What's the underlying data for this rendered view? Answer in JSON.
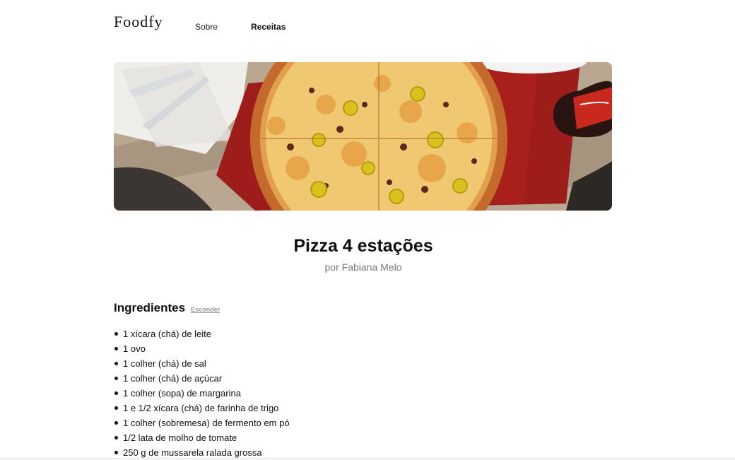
{
  "header": {
    "logo": "Foodfy",
    "nav": [
      {
        "label": "Sobre"
      },
      {
        "label": "Receitas"
      }
    ]
  },
  "hero": {
    "alt": "Pizza 4 estações"
  },
  "recipe": {
    "title": "Pizza 4 estações",
    "author": "por Fabiana Melo"
  },
  "ingredients": {
    "title": "Ingredientes",
    "toggle_label": "Esconder",
    "items": [
      "1 xícara (chá) de leite",
      "1 ovo",
      "1 colher (chá) de sal",
      "1 colher (chá) de açúcar",
      "1 colher (sopa) de margarina",
      "1 e 1/2 xícara (chá) de farinha de trigo",
      "1 colher (sobremesa) de fermento em pó",
      "1/2 lata de molho de tomate",
      "250 g de mussarela ralada grossa"
    ]
  }
}
